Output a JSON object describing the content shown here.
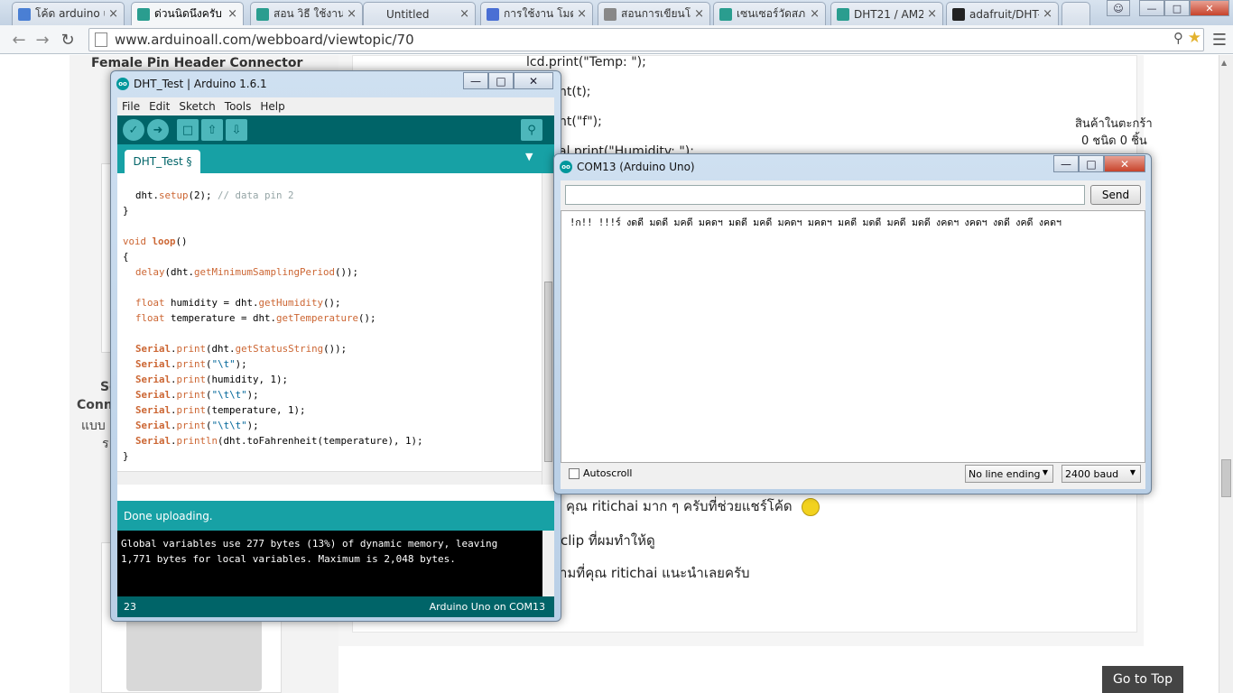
{
  "browser": {
    "tabs": [
      {
        "label": "โค้ด arduino u",
        "icon": "google-icon",
        "color": "#4a7fd4"
      },
      {
        "label": "ด่วนนิดนึงครับ :",
        "icon": "arduinoall-icon",
        "color": "#2a9d8f"
      },
      {
        "label": "สอน วิธี ใช้งาน",
        "icon": "arduinoall-icon",
        "color": "#2a9d8f"
      },
      {
        "label": "Untitled",
        "icon": "",
        "color": ""
      },
      {
        "label": "การใช้งาน โมดู",
        "icon": "cube-icon",
        "color": "#4a6fd4"
      },
      {
        "label": "สอนการเขียนโ",
        "icon": "page-icon",
        "color": "#888888"
      },
      {
        "label": "เซนเซอร์วัดสภา",
        "icon": "arduinoall-icon",
        "color": "#2a9d8f"
      },
      {
        "label": "DHT21 / AM2",
        "icon": "arduinoall-icon",
        "color": "#2a9d8f"
      },
      {
        "label": "adafruit/DHT-",
        "icon": "github-icon",
        "color": "#222222"
      }
    ],
    "url": "www.arduinoall.com/webboard/viewtopic/70"
  },
  "page": {
    "left_heading": "Female Pin Header Connector",
    "left_frag1": "Se",
    "left_frag2": "Conn",
    "left_frag3": "แบบ",
    "left_frag4": "ร",
    "code1": "lcd.print(\"Temp: \");",
    "code2": "nt(t);",
    "code3": "nt(\"f\");",
    "code4": "al.print(\"Humidity: \");",
    "cart_title": "สินค้าในตะกร้า",
    "cart_count": "0 ชนิด 0 ชิ้น",
    "msg1": "คุณ ritichai  มาก ๆ ครับที่ช่วยแชร์โค้ด",
    "msg2": "clip ที่ผมทำให้ดู",
    "msg3": "ามที่คุณ ritichai แนะนำเลยครับ",
    "go_top": "Go to Top"
  },
  "ide": {
    "title": "DHT_Test | Arduino 1.6.1",
    "menus": [
      "File",
      "Edit",
      "Sketch",
      "Tools",
      "Help"
    ],
    "tab": "DHT_Test §",
    "status": "Done uploading.",
    "console": [
      "Global variables use 277 bytes (13%) of dynamic memory, leaving",
      "1,771 bytes for local variables. Maximum is 2,048 bytes."
    ],
    "line": "23",
    "board": "Arduino Uno on COM13"
  },
  "serial": {
    "title": "COM13 (Arduino Uno)",
    "input": "",
    "send": "Send",
    "output": "!ก!! !!!ร์ งดดี มดดี มคดี มคดฯ มดดี มคดี มคดฯ มคดฯ มคดี มดดี มคดี มดดี งคดฯ งคดฯ งดดี งคดี งคดฯ",
    "autoscroll": "Autoscroll",
    "line_ending": "No line ending",
    "baud": "2400 baud"
  }
}
